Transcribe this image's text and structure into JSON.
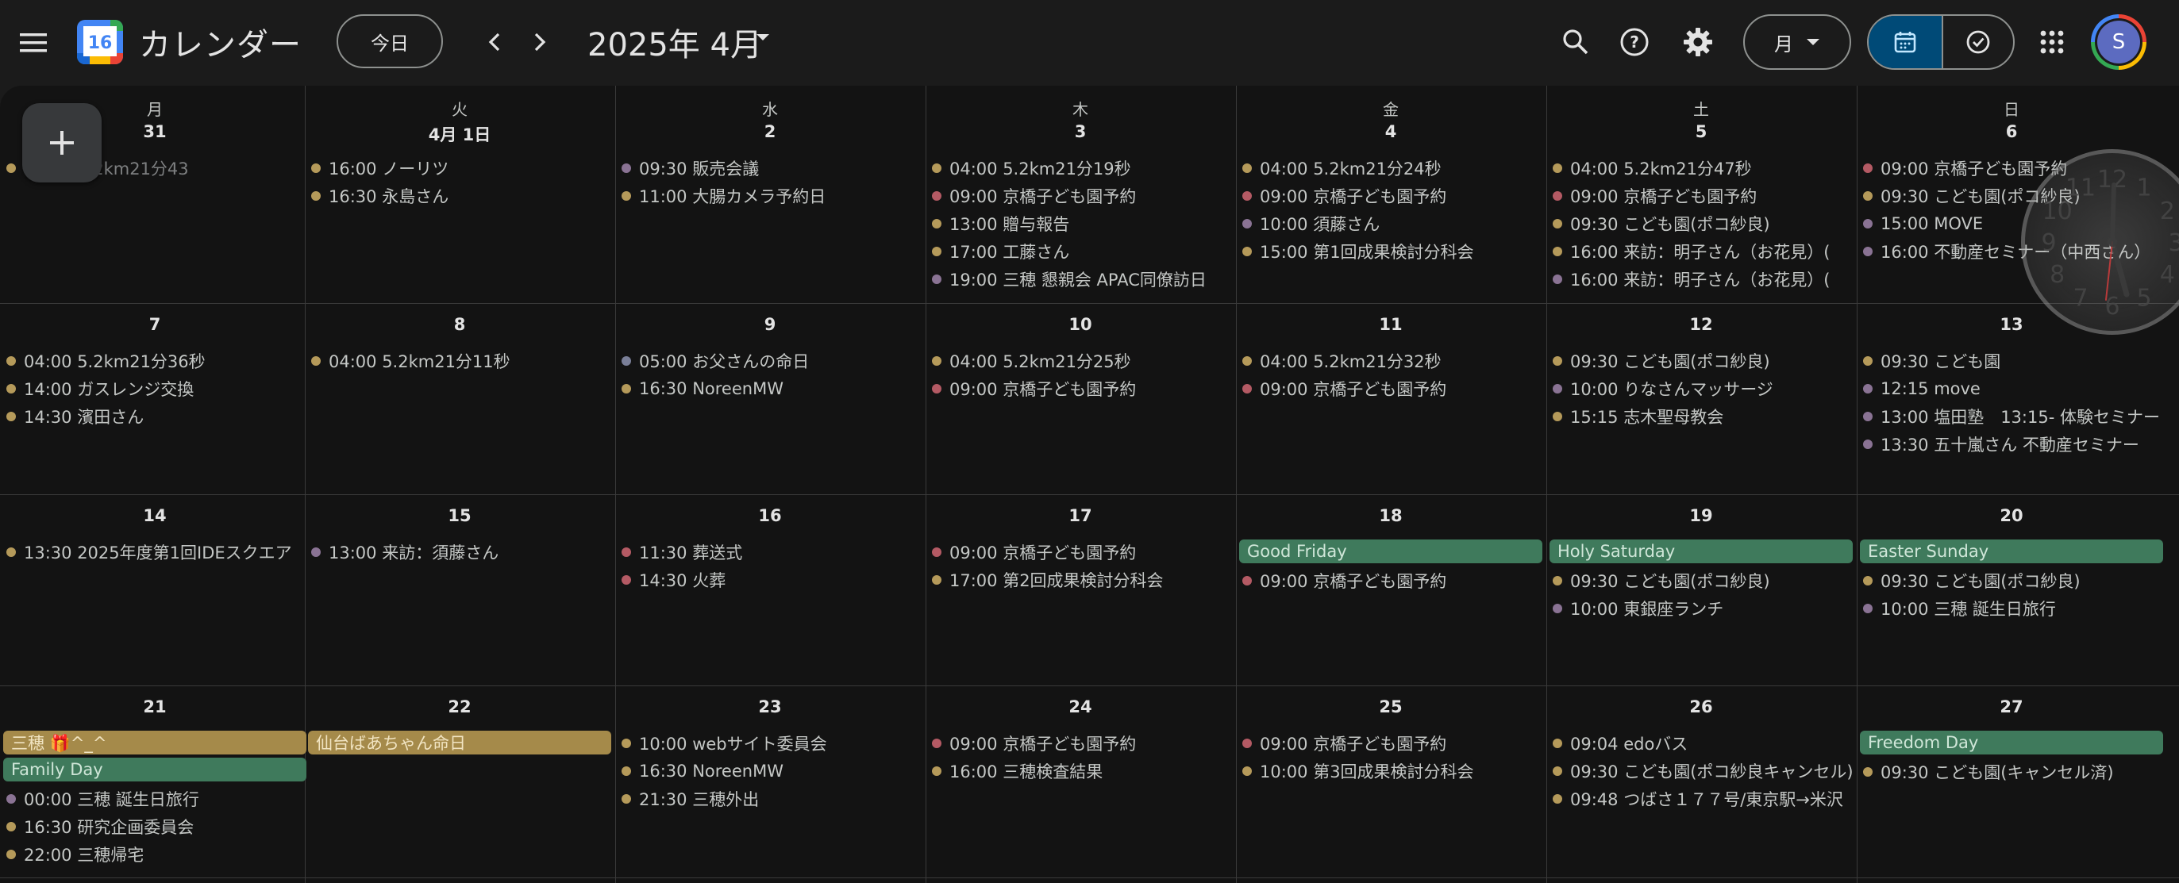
{
  "header": {
    "app_title": "カレンダー",
    "logo_day": "16",
    "today_label": "今日",
    "month_title": "2025年 4月",
    "view_label": "月",
    "avatar_letter": "S"
  },
  "colors": {
    "background": "#131313",
    "header_bg": "#1b1b1b",
    "dot_gold": "#b59a5a",
    "dot_red": "#b45a64",
    "dot_purple": "#8a7394",
    "dot_gray_blue": "#7a7f98",
    "allday_green": "#3f7a5c",
    "allday_gold": "#a58a4a",
    "toggle_active": "#004a77"
  },
  "weekdays": [
    "月",
    "火",
    "水",
    "木",
    "金",
    "土",
    "日"
  ],
  "weeks": [
    {
      "days": [
        {
          "num": "31",
          "events": [
            {
              "t": "04:00 5.2km21分43",
              "c": "gold",
              "dim": true
            }
          ]
        },
        {
          "num": "4月 1日",
          "events": [
            {
              "t": "16:00 ノーリツ",
              "c": "gold"
            },
            {
              "t": "16:30 永島さん",
              "c": "gold"
            }
          ]
        },
        {
          "num": "2",
          "events": [
            {
              "t": "09:30 販売会議",
              "c": "purple"
            },
            {
              "t": "11:00 大腸カメラ予約日",
              "c": "gold"
            }
          ]
        },
        {
          "num": "3",
          "events": [
            {
              "t": "04:00 5.2km21分19秒",
              "c": "gold"
            },
            {
              "t": "09:00 京橋子ども園予約",
              "c": "red"
            },
            {
              "t": "13:00 贈与報告",
              "c": "gold"
            },
            {
              "t": "17:00 工藤さん",
              "c": "gold"
            },
            {
              "t": "19:00 三穂 懇親会 APAC同僚訪日",
              "c": "purple"
            }
          ]
        },
        {
          "num": "4",
          "events": [
            {
              "t": "04:00 5.2km21分24秒",
              "c": "gold"
            },
            {
              "t": "09:00 京橋子ども園予約",
              "c": "red"
            },
            {
              "t": "10:00 須藤さん",
              "c": "purple"
            },
            {
              "t": "15:00 第1回成果検討分科会",
              "c": "gold"
            }
          ]
        },
        {
          "num": "5",
          "events": [
            {
              "t": "04:00 5.2km21分47秒",
              "c": "gold"
            },
            {
              "t": "09:00 京橋子ども園予約",
              "c": "red"
            },
            {
              "t": "09:30 こども園(ポコ紗良)",
              "c": "gold"
            },
            {
              "t": "16:00 来訪：明子さん（お花見）(",
              "c": "gold"
            },
            {
              "t": "16:00 来訪：明子さん（お花見）(",
              "c": "purple"
            }
          ]
        },
        {
          "num": "6",
          "events": [
            {
              "t": "09:00 京橋子ども園予約",
              "c": "red"
            },
            {
              "t": "09:30 こども園(ポコ紗良)",
              "c": "gold"
            },
            {
              "t": "15:00 MOVE",
              "c": "purple"
            },
            {
              "t": "16:00 不動産セミナー（中西さん）",
              "c": "purple"
            }
          ]
        }
      ]
    },
    {
      "days": [
        {
          "num": "7",
          "events": [
            {
              "t": "04:00 5.2km21分36秒",
              "c": "gold"
            },
            {
              "t": "14:00 ガスレンジ交換",
              "c": "gold"
            },
            {
              "t": "14:30 濱田さん",
              "c": "gold"
            }
          ]
        },
        {
          "num": "8",
          "events": [
            {
              "t": "04:00 5.2km21分11秒",
              "c": "gold"
            }
          ]
        },
        {
          "num": "9",
          "events": [
            {
              "t": "05:00 お父さんの命日",
              "c": "grayblue"
            },
            {
              "t": "16:30 NoreenMW",
              "c": "gold"
            }
          ]
        },
        {
          "num": "10",
          "events": [
            {
              "t": "04:00 5.2km21分25秒",
              "c": "gold"
            },
            {
              "t": "09:00 京橋子ども園予約",
              "c": "red"
            }
          ]
        },
        {
          "num": "11",
          "events": [
            {
              "t": "04:00 5.2km21分32秒",
              "c": "gold"
            },
            {
              "t": "09:00 京橋子ども園予約",
              "c": "red"
            }
          ]
        },
        {
          "num": "12",
          "events": [
            {
              "t": "09:30 こども園(ポコ紗良)",
              "c": "gold"
            },
            {
              "t": "10:00 りなさんマッサージ",
              "c": "purple"
            },
            {
              "t": "15:15 志木聖母教会",
              "c": "gold"
            }
          ]
        },
        {
          "num": "13",
          "events": [
            {
              "t": "09:30 こども園",
              "c": "gold"
            },
            {
              "t": "12:15 move",
              "c": "purple"
            },
            {
              "t": "13:00 塩田塾　13:15- 体験セミナー",
              "c": "purple"
            },
            {
              "t": "13:30 五十嵐さん 不動産セミナー",
              "c": "purple"
            }
          ]
        }
      ]
    },
    {
      "days": [
        {
          "num": "14",
          "events": [
            {
              "t": "13:30 2025年度第1回IDEスクエア",
              "c": "gold"
            }
          ]
        },
        {
          "num": "15",
          "events": [
            {
              "t": "13:00 来訪：須藤さん",
              "c": "purple"
            }
          ]
        },
        {
          "num": "16",
          "events": [
            {
              "t": "11:30 葬送式",
              "c": "red"
            },
            {
              "t": "14:30 火葬",
              "c": "red"
            }
          ]
        },
        {
          "num": "17",
          "events": [
            {
              "t": "09:00 京橋子ども園予約",
              "c": "red"
            },
            {
              "t": "17:00 第2回成果検討分科会",
              "c": "gold"
            }
          ]
        },
        {
          "num": "18",
          "allday": [
            {
              "t": "Good Friday",
              "c": "green"
            }
          ],
          "events": [
            {
              "t": "09:00 京橋子ども園予約",
              "c": "red"
            }
          ]
        },
        {
          "num": "19",
          "allday": [
            {
              "t": "Holy Saturday",
              "c": "green"
            }
          ],
          "events": [
            {
              "t": "09:30 こども園(ポコ紗良)",
              "c": "gold"
            },
            {
              "t": "10:00 東銀座ランチ",
              "c": "purple"
            }
          ]
        },
        {
          "num": "20",
          "allday": [
            {
              "t": "Easter Sunday",
              "c": "green"
            }
          ],
          "events": [
            {
              "t": "09:30 こども園(ポコ紗良)",
              "c": "gold"
            },
            {
              "t": "10:00 三穂 誕生日旅行",
              "c": "purple"
            }
          ]
        }
      ]
    },
    {
      "days": [
        {
          "num": "21",
          "allday": [
            {
              "t": "三穂 🎁^_^",
              "c": "goldbar"
            },
            {
              "t": "Family Day",
              "c": "green"
            }
          ],
          "events": [
            {
              "t": "00:00 三穂 誕生日旅行",
              "c": "purple"
            },
            {
              "t": "16:30 研究企画委員会",
              "c": "gold"
            },
            {
              "t": "22:00 三穂帰宅",
              "c": "gold"
            }
          ]
        },
        {
          "num": "22",
          "allday": [
            {
              "t": "仙台ばあちゃん命日",
              "c": "goldbar"
            }
          ],
          "events": []
        },
        {
          "num": "23",
          "events": [
            {
              "t": "10:00 webサイト委員会",
              "c": "gold"
            },
            {
              "t": "16:30 NoreenMW",
              "c": "gold"
            },
            {
              "t": "21:30 三穂外出",
              "c": "gold"
            }
          ]
        },
        {
          "num": "24",
          "events": [
            {
              "t": "09:00 京橋子ども園予約",
              "c": "red"
            },
            {
              "t": "16:00 三穂検査結果",
              "c": "gold"
            }
          ]
        },
        {
          "num": "25",
          "events": [
            {
              "t": "09:00 京橋子ども園予約",
              "c": "red"
            },
            {
              "t": "10:00 第3回成果検討分科会",
              "c": "gold"
            }
          ]
        },
        {
          "num": "26",
          "events": [
            {
              "t": "09:04 edoバス",
              "c": "gold"
            },
            {
              "t": "09:30 こども園(ポコ紗良キャンセル)",
              "c": "gold"
            },
            {
              "t": "09:48 つばさ１７７号/東京駅→米沢",
              "c": "gold"
            }
          ]
        },
        {
          "num": "27",
          "allday": [
            {
              "t": "Freedom Day",
              "c": "green"
            }
          ],
          "events": [
            {
              "t": "09:30 こども園(キャンセル済)",
              "c": "gold"
            }
          ]
        }
      ]
    }
  ],
  "clock_numbers": [
    "12",
    "1",
    "2",
    "3",
    "4",
    "5",
    "6",
    "7",
    "8",
    "9",
    "10",
    "11"
  ],
  "icons": [
    "hamburger-menu-icon",
    "calendar-logo-icon",
    "chevron-left-icon",
    "chevron-right-icon",
    "caret-down-icon",
    "search-icon",
    "help-icon",
    "gear-icon",
    "calendar-icon",
    "task-check-icon",
    "apps-grid-icon",
    "plus-icon",
    "analog-clock-icon"
  ]
}
